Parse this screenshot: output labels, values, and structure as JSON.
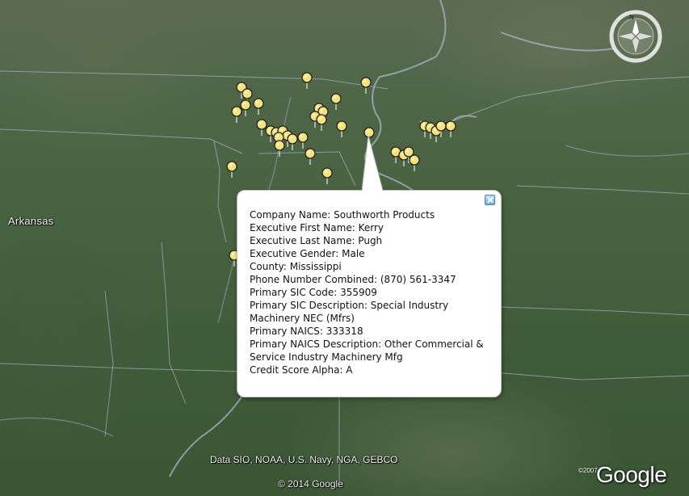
{
  "map": {
    "state_label": "Arkansas",
    "attribution_data": "Data SIO, NOAA, U.S. Navy, NGA, GEBCO",
    "attribution_copyright": "© 2014 Google",
    "logo_text": "Google",
    "logo_year": "©2007",
    "compass_north": "N",
    "placemark_color": "#f5e27a"
  },
  "balloon": {
    "lines": [
      "Company Name: Southworth Products",
      "Executive First Name: Kerry",
      "Executive Last Name: Pugh",
      "Executive Gender: Male",
      "County: Mississippi",
      "Phone Number Combined: (870) 561-3347",
      "Primary SIC Code: 355909",
      "Primary SIC Description: Special Industry Machinery NEC (Mfrs)",
      "Primary NAICS: 333318",
      "Primary NAICS Description: Other Commercial & Service Industry Machinery Mfg",
      "Credit Score Alpha: A"
    ]
  }
}
